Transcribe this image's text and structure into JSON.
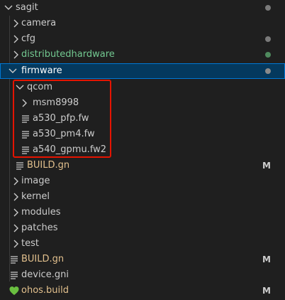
{
  "explorer": {
    "root": {
      "label": "sagit",
      "dot_color": "#7a7a7a"
    },
    "items": [
      {
        "label": "camera",
        "kind": "folder",
        "expanded": false
      },
      {
        "label": "cfg",
        "kind": "folder",
        "expanded": false,
        "dot_color": "#7a7a7a"
      },
      {
        "label": "distributedhardware",
        "kind": "folder",
        "expanded": false,
        "label_color": "#73c991",
        "dot_color": "#4f8a5e"
      },
      {
        "label": "firmware",
        "kind": "folder",
        "expanded": true,
        "selected": true,
        "dot_color": "#8a8a8a"
      },
      {
        "label": "qcom",
        "kind": "folder",
        "expanded": true
      },
      {
        "label": "msm8998",
        "kind": "folder",
        "expanded": false
      },
      {
        "label": "a530_pfp.fw",
        "kind": "file"
      },
      {
        "label": "a530_pm4.fw",
        "kind": "file"
      },
      {
        "label": "a540_gpmu.fw2",
        "kind": "file"
      },
      {
        "label": "BUILD.gn",
        "kind": "file",
        "status": "M"
      },
      {
        "label": "image",
        "kind": "folder",
        "expanded": false
      },
      {
        "label": "kernel",
        "kind": "folder",
        "expanded": false
      },
      {
        "label": "modules",
        "kind": "folder",
        "expanded": false
      },
      {
        "label": "patches",
        "kind": "folder",
        "expanded": false
      },
      {
        "label": "test",
        "kind": "folder",
        "expanded": false
      },
      {
        "label": "BUILD.gn",
        "kind": "file",
        "status": "M"
      },
      {
        "label": "device.gni",
        "kind": "file"
      },
      {
        "label": "ohos.build",
        "kind": "file",
        "icon": "heart-icon",
        "status": "M"
      }
    ],
    "colors": {
      "modified": "#e2c08d",
      "badge": "#e2c08d",
      "highlight_border": "#e51400",
      "heart": "#6abf40"
    }
  }
}
